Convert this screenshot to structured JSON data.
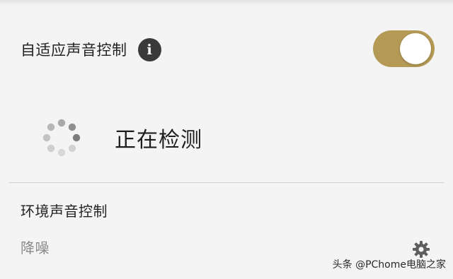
{
  "adaptive": {
    "label": "自适应声音控制",
    "info_icon_glyph": "i",
    "toggle_on": true,
    "toggle_color": "#b49a55"
  },
  "status": {
    "text": "正在检测",
    "spinner_icon": "loading-spinner-icon"
  },
  "ambient": {
    "title": "环境声音控制",
    "mode": "降噪",
    "settings_icon": "gear-icon"
  },
  "watermark": "头条 @PChome电脑之家"
}
